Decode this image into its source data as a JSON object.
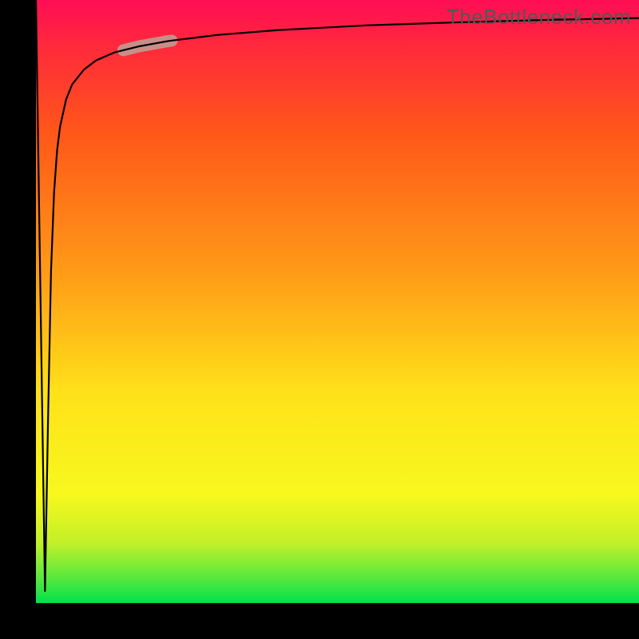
{
  "watermark": "TheBottleneck.com",
  "chart_data": {
    "type": "line",
    "title": "",
    "xlabel": "",
    "ylabel": "",
    "xlim": [
      0,
      1
    ],
    "ylim": [
      0,
      100
    ],
    "background_gradient": {
      "direction": "vertical",
      "description": "Bottleneck-percentage heatmap; green at y=0 rising through yellow and orange to red at y=100",
      "stops": [
        {
          "y": 0,
          "color": "#00e24b"
        },
        {
          "y": 4,
          "color": "#55e83e"
        },
        {
          "y": 10,
          "color": "#c2f028"
        },
        {
          "y": 18,
          "color": "#f7f81e"
        },
        {
          "y": 35,
          "color": "#ffe119"
        },
        {
          "y": 55,
          "color": "#ff9a17"
        },
        {
          "y": 78,
          "color": "#ff5719"
        },
        {
          "y": 92,
          "color": "#ff2a3a"
        },
        {
          "y": 100,
          "color": "#ff0d55"
        }
      ]
    },
    "series": [
      {
        "name": "bottleneck-curve",
        "color": "#000000",
        "x": [
          0.0,
          0.015,
          0.02,
          0.025,
          0.03,
          0.035,
          0.04,
          0.05,
          0.06,
          0.08,
          0.1,
          0.13,
          0.17,
          0.22,
          0.3,
          0.4,
          0.55,
          0.7,
          0.85,
          1.0
        ],
        "values": [
          100.0,
          2.0,
          30.0,
          55.0,
          68.0,
          75.0,
          79.0,
          83.5,
          86.0,
          88.5,
          90.0,
          91.3,
          92.3,
          93.2,
          94.2,
          95.0,
          95.8,
          96.3,
          96.7,
          97.0
        ]
      }
    ],
    "highlight_segment": {
      "series": "bottleneck-curve",
      "x_range": [
        0.145,
        0.225
      ],
      "stroke_color": "#c78f88",
      "stroke_width_px": 15
    }
  }
}
